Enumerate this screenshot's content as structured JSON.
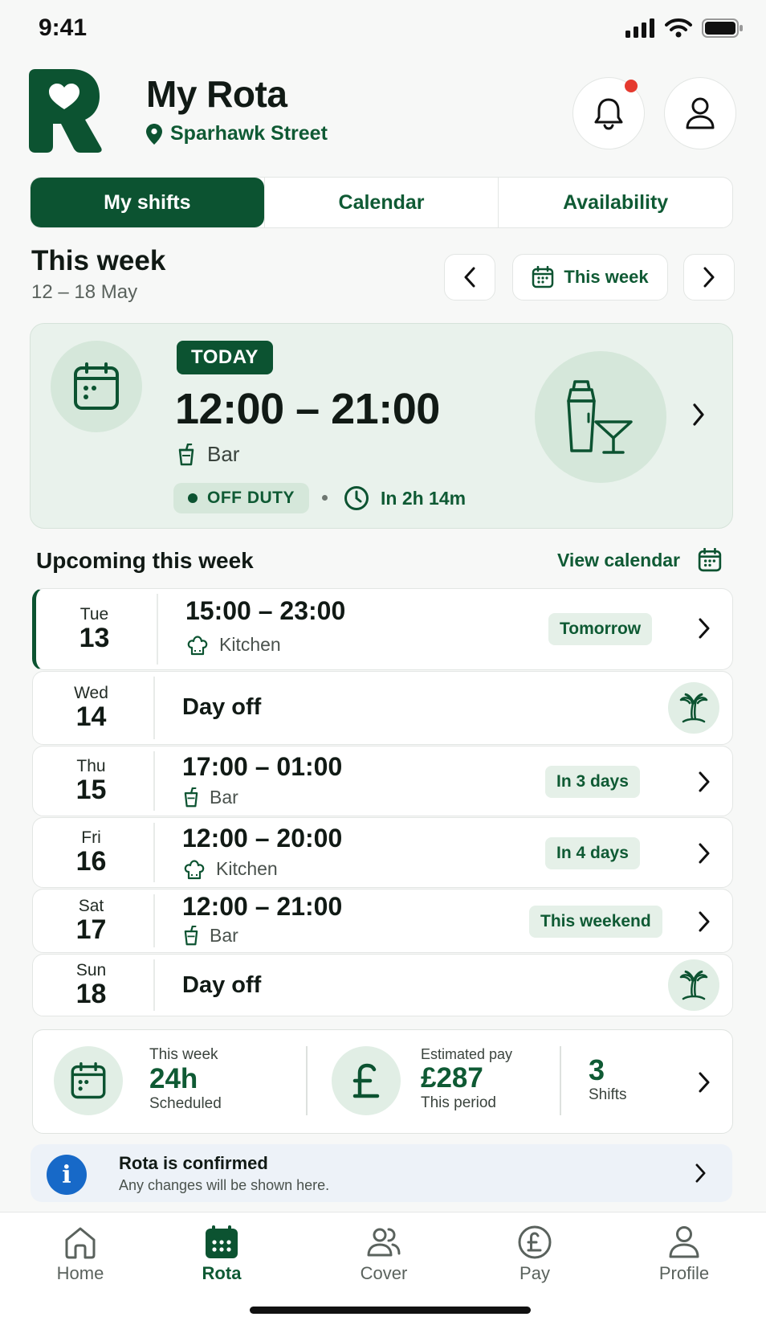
{
  "status_bar": {
    "time": "9:41"
  },
  "header": {
    "title": "My Rota",
    "location": "Sparhawk Street",
    "has_notification": true
  },
  "tabs": [
    {
      "label": "My shifts",
      "active": true
    },
    {
      "label": "Calendar",
      "active": false
    },
    {
      "label": "Availability",
      "active": false
    }
  ],
  "week": {
    "title": "This week",
    "range": "12 – 18 May",
    "picker_label": "This week"
  },
  "today": {
    "badge": "TODAY",
    "time": "12:00 – 21:00",
    "department": "Bar",
    "status": "OFF DUTY",
    "starts_in": "In 2h 14m"
  },
  "upcoming": {
    "title": "Upcoming this week",
    "view_calendar": "View calendar",
    "rows": [
      {
        "day_name": "Tue",
        "day_num": "13",
        "time": "15:00 – 23:00",
        "dept": "Kitchen",
        "pill": "Tomorrow"
      },
      {
        "day_name": "Wed",
        "day_num": "14",
        "day_off": "Day off"
      },
      {
        "day_name": "Thu",
        "day_num": "15",
        "time": "17:00 – 01:00",
        "dept": "Bar",
        "pill": "In 3 days"
      },
      {
        "day_name": "Fri",
        "day_num": "16",
        "time": "12:00 – 20:00",
        "dept": "Kitchen",
        "pill": "In 4 days"
      },
      {
        "day_name": "Sat",
        "day_num": "17",
        "time": "12:00 – 21:00",
        "dept": "Bar",
        "pill": "This weekend"
      },
      {
        "day_name": "Sun",
        "day_num": "18",
        "day_off": "Day off"
      }
    ]
  },
  "summary": {
    "hours": {
      "label": "This week",
      "value": "24h",
      "sub": "Scheduled"
    },
    "pay": {
      "label": "Estimated pay",
      "value": "£287",
      "sub": "This period"
    },
    "shifts": {
      "value": "3",
      "sub": "Shifts"
    }
  },
  "info": {
    "title": "Rota is confirmed",
    "subtitle": "Any changes will be shown here."
  },
  "bottom_nav": [
    {
      "label": "Home",
      "icon": "home-icon"
    },
    {
      "label": "Rota",
      "icon": "calendar-grid-icon",
      "active": true
    },
    {
      "label": "Cover",
      "icon": "people-icon"
    },
    {
      "label": "Pay",
      "icon": "pound-coin-icon"
    },
    {
      "label": "Profile",
      "icon": "user-icon"
    }
  ],
  "colors": {
    "brand": "#0c5331",
    "accent_light": "#e9f2ec",
    "notification": "#e53a2f",
    "info": "#1769c8"
  }
}
